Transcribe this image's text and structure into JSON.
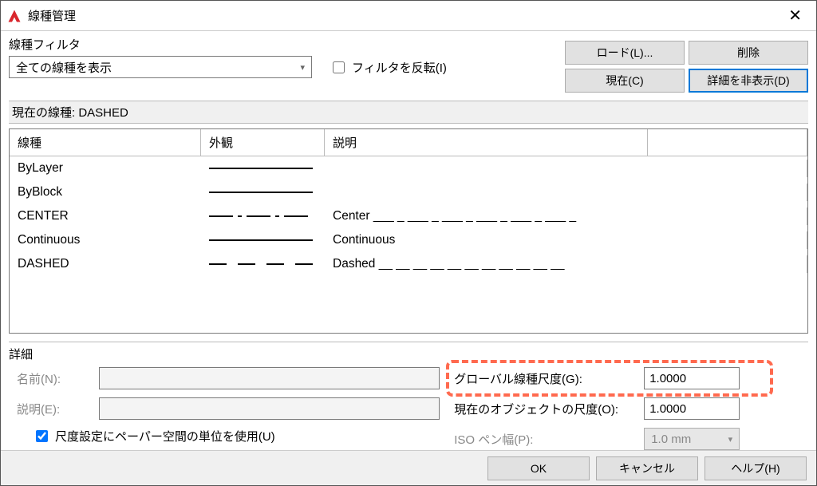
{
  "window": {
    "title": "線種管理"
  },
  "filter": {
    "group_label": "線種フィルタ",
    "dropdown_value": "全ての線種を表示",
    "invert_label": "フィルタを反転(I)"
  },
  "buttons": {
    "load": "ロード(L)...",
    "delete": "削除",
    "current": "現在(C)",
    "hide_details": "詳細を非表示(D)"
  },
  "current_linetype": {
    "prefix": "現在の線種:",
    "value": "DASHED"
  },
  "table": {
    "headers": {
      "name": "線種",
      "appearance": "外観",
      "description": "説明"
    },
    "rows": [
      {
        "name": "ByLayer",
        "pattern": "solid",
        "description": ""
      },
      {
        "name": "ByBlock",
        "pattern": "solid",
        "description": ""
      },
      {
        "name": "CENTER",
        "pattern": "center",
        "description": "Center ___ _ ___ _ ___ _ ___ _ ___ _ ___ _"
      },
      {
        "name": "Continuous",
        "pattern": "solid",
        "description": "Continuous"
      },
      {
        "name": "DASHED",
        "pattern": "dashed",
        "description": "Dashed __ __ __ __ __ __ __ __ __ __ __"
      }
    ]
  },
  "details": {
    "group_label": "詳細",
    "name_label": "名前(N):",
    "name_value": "",
    "desc_label": "説明(E):",
    "desc_value": "",
    "paperspace_label": "尺度設定にペーパー空間の単位を使用(U)",
    "paperspace_checked": true,
    "global_scale_label": "グローバル線種尺度(G):",
    "global_scale_value": "1.0000",
    "object_scale_label": "現在のオブジェクトの尺度(O):",
    "object_scale_value": "1.0000",
    "iso_pen_label": "ISO ペン幅(P):",
    "iso_pen_value": "1.0 mm"
  },
  "footer": {
    "ok": "OK",
    "cancel": "キャンセル",
    "help": "ヘルプ(H)"
  }
}
